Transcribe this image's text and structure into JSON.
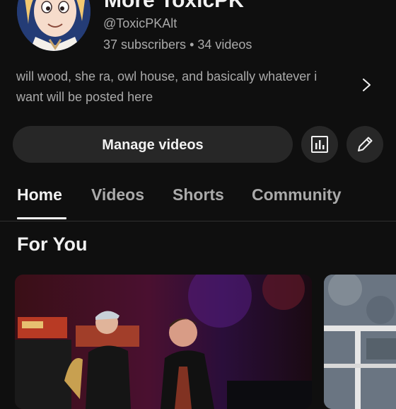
{
  "channel": {
    "name": "More ToxicPK",
    "handle": "@ToxicPKAlt",
    "subscribers": "37 subscribers",
    "separator": "•",
    "videos": "34 videos",
    "description": "will wood, she ra, owl house, and basically whatever i want will be posted here"
  },
  "actions": {
    "manage_label": "Manage videos"
  },
  "tabs": [
    {
      "label": "Home",
      "active": true
    },
    {
      "label": "Videos",
      "active": false
    },
    {
      "label": "Shorts",
      "active": false
    },
    {
      "label": "Community",
      "active": false
    }
  ],
  "section": {
    "title": "For You"
  },
  "icons": {
    "description": "chevron-right-icon",
    "analytics": "analytics-icon",
    "edit": "pencil-icon"
  },
  "colors": {
    "background": "#0f0f0f",
    "button_bg": "#272727",
    "text_primary": "#f1f1f1",
    "text_secondary": "#aaaaaa"
  }
}
